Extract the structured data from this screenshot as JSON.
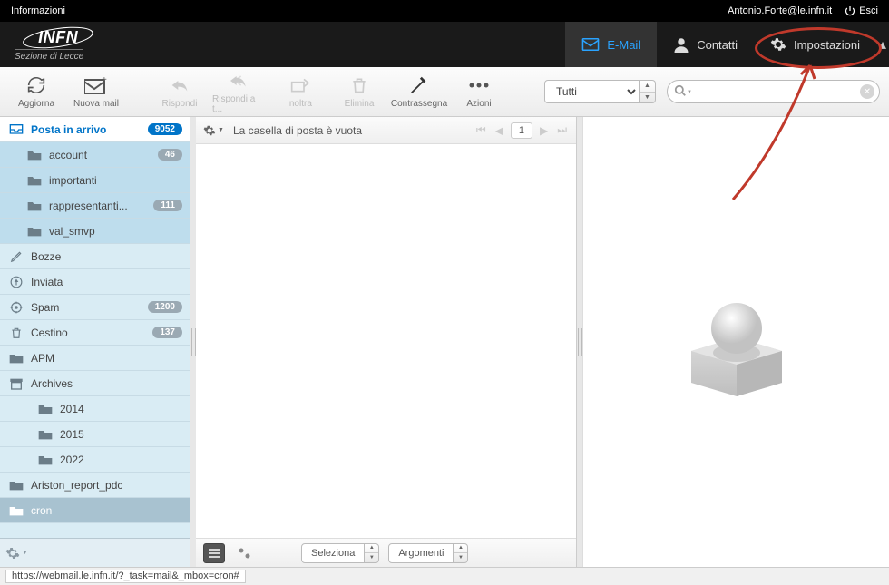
{
  "top": {
    "info": "Informazioni",
    "user": "Antonio.Forte@le.infn.it",
    "logout": "Esci"
  },
  "brand": {
    "name": "INFN",
    "sub": "Sezione di Lecce"
  },
  "nav": {
    "email": "E-Mail",
    "contacts": "Contatti",
    "settings": "Impostazioni"
  },
  "toolbar": {
    "refresh": "Aggiorna",
    "newmail": "Nuova mail",
    "reply": "Rispondi",
    "replyall": "Rispondi a t...",
    "forward": "Inoltra",
    "delete": "Elimina",
    "flag": "Contrassegna",
    "actions": "Azioni",
    "filter": "Tutti",
    "search_placeholder": ""
  },
  "folders": {
    "inbox": {
      "label": "Posta in arrivo",
      "count": "9052"
    },
    "sub": [
      {
        "label": "account",
        "count": "46"
      },
      {
        "label": "importanti",
        "count": null
      },
      {
        "label": "rappresentanti...",
        "count": "111"
      },
      {
        "label": "val_smvp",
        "count": null
      }
    ],
    "drafts": "Bozze",
    "sent": "Inviata",
    "spam": {
      "label": "Spam",
      "count": "1200"
    },
    "trash": {
      "label": "Cestino",
      "count": "137"
    },
    "apm": "APM",
    "archives": "Archives",
    "archive_sub": [
      "2014",
      "2015",
      "2022"
    ],
    "ariston": "Ariston_report_pdc",
    "cron": "cron"
  },
  "list": {
    "empty_msg": "La casella di posta è vuota",
    "page": "1"
  },
  "footer": {
    "select": "Seleziona",
    "threads": "Argomenti"
  },
  "status": "https://webmail.le.infn.it/?_task=mail&_mbox=cron#"
}
